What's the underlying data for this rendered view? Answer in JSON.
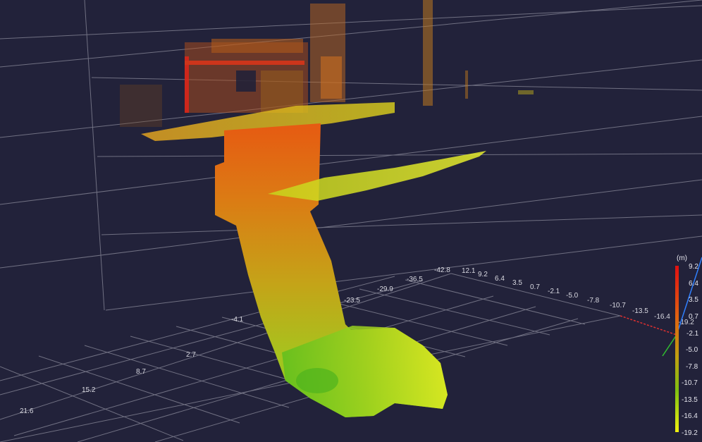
{
  "grid_axes": {
    "x_ticks": [
      "-42.8",
      "-36.5",
      "-29.9",
      "-23.5",
      "-4.1",
      "2.7",
      "8.7",
      "15.2",
      "21.6"
    ],
    "y_ticks": [
      "12.1",
      "9.2",
      "6.4",
      "3.5",
      "0.7",
      "-2.1",
      "-5.0",
      "-7.8",
      "-10.7",
      "-13.5",
      "-16.4",
      "-19.2"
    ]
  },
  "colorbar": {
    "unit": "(m)",
    "ticks": [
      "9.2",
      "6.4",
      "3.5",
      "0.7",
      "-2.1",
      "-5.0",
      "-7.8",
      "-10.7",
      "-13.5",
      "-16.4",
      "-19.2"
    ],
    "colors": {
      "top": "#e01010",
      "upper": "#e06010",
      "mid": "#c0a010",
      "lower": "#80c010",
      "bottom": "#f0f010"
    }
  },
  "point_cloud": {
    "colors": {
      "high": "#e03010",
      "mid": "#d0a010",
      "low": "#60c020",
      "lowest": "#e8f020"
    }
  },
  "axis_gizmo": {
    "x_color": "#e03030",
    "y_color": "#30c030",
    "z_color": "#3080ff"
  }
}
